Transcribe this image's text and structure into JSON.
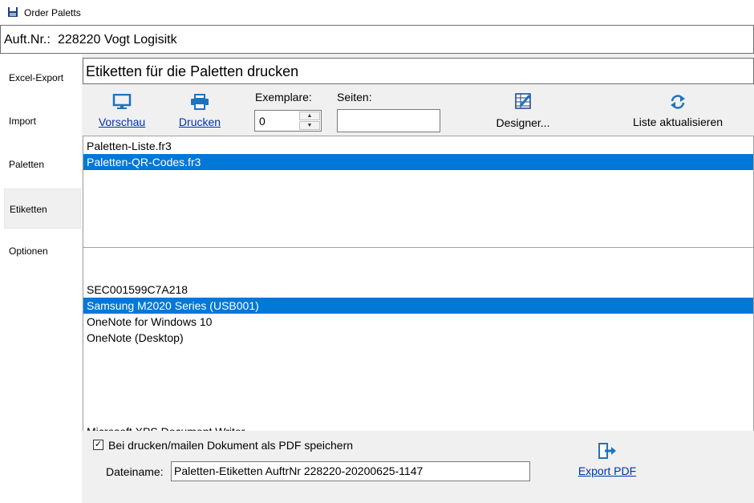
{
  "window": {
    "title": "Order Paletts"
  },
  "order": {
    "label": "Auft.Nr.:",
    "value": "228220 Vogt Logisitk"
  },
  "sidebar": {
    "items": [
      {
        "label": "Excel-Export"
      },
      {
        "label": "Import"
      },
      {
        "label": "Paletten"
      },
      {
        "label": "Etiketten"
      },
      {
        "label": "Optionen"
      }
    ]
  },
  "section": {
    "title": "Etiketten für die Paletten drucken"
  },
  "toolbar": {
    "preview_label": "Vorschau",
    "print_label": "Drucken",
    "copies_label": "Exemplare:",
    "copies_value": "0",
    "pages_label": "Seiten:",
    "pages_value": "",
    "designer_label": "Designer...",
    "refresh_label": "Liste aktualisieren"
  },
  "reports": {
    "items": [
      "Paletten-Liste.fr3",
      "Paletten-QR-Codes.fr3"
    ],
    "selected": "Paletten-QR-Codes.fr3"
  },
  "printers": {
    "items": [
      "SEC001599C7A218",
      "Samsung M2020 Series (USB001)",
      "OneNote for Windows 10",
      "OneNote (Desktop)",
      "Microsoft XPS Document Writer"
    ],
    "selected": "Samsung M2020 Series (USB001)"
  },
  "pdf": {
    "checkbox_label": "Bei drucken/mailen Dokument als PDF speichern",
    "checked": true,
    "filename_label": "Dateiname:",
    "filename_value": "Paletten-Etiketten AuftrNr 228220-20200625-1147",
    "export_label": "Export PDF"
  },
  "colors": {
    "selection": "#0078d7",
    "link": "#0033aa",
    "icon_blue": "#1e73be"
  }
}
